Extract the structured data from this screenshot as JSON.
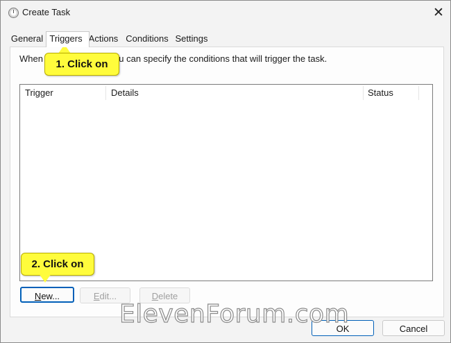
{
  "window": {
    "title": "Create Task",
    "close_glyph": "✕"
  },
  "tabs": [
    {
      "label": "General"
    },
    {
      "label": "Triggers"
    },
    {
      "label": "Actions"
    },
    {
      "label": "Conditions"
    },
    {
      "label": "Settings"
    }
  ],
  "triggers_tab": {
    "description_visible_start": "When y",
    "description_visible_end": "ou can specify the conditions that will trigger the task.",
    "columns": [
      "Trigger",
      "Details",
      "Status"
    ],
    "rows": []
  },
  "buttons": {
    "new_first": "N",
    "new_rest": "ew...",
    "edit_first": "E",
    "edit_rest": "dit...",
    "delete_first": "D",
    "delete_rest": "elete",
    "ok": "OK",
    "cancel": "Cancel"
  },
  "annotations": {
    "callout1": "1. Click on",
    "callout2": "2. Click on",
    "highlight_color": "#fffc3c"
  },
  "watermark": "ElevenForum.com",
  "icons": {
    "app": "task-scheduler-clock-icon",
    "close": "close-icon"
  }
}
